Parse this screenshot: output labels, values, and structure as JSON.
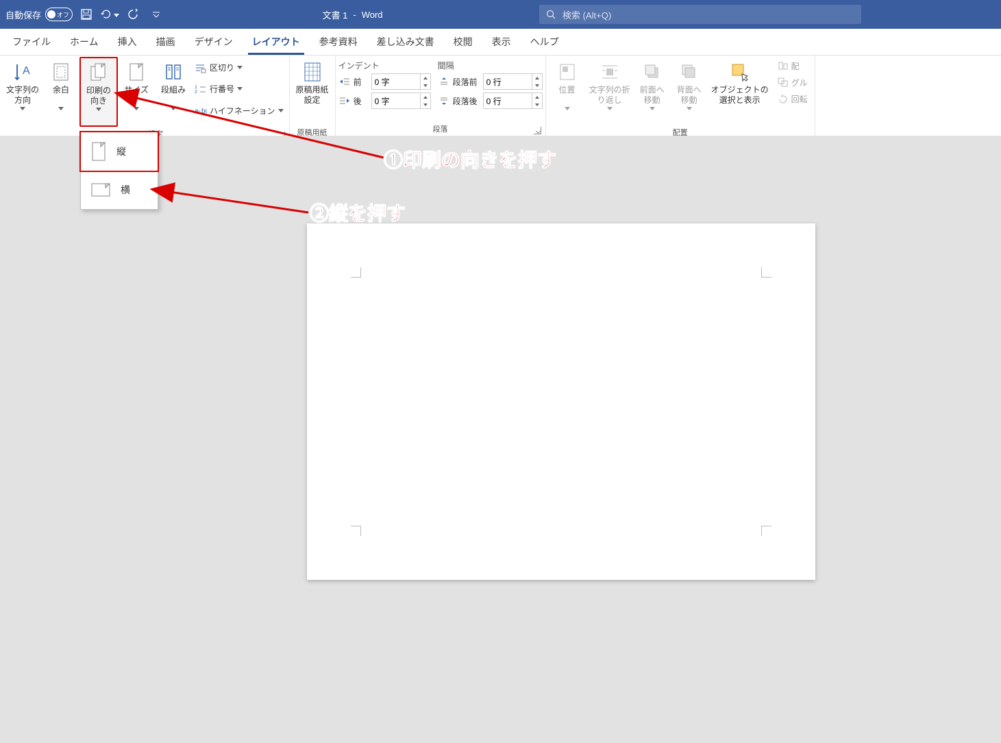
{
  "titlebar": {
    "autosave_label": "自動保存",
    "autosave_state": "オフ",
    "doc_title": "文書 1",
    "app_name": "Word",
    "search_placeholder": "検索 (Alt+Q)"
  },
  "tabs": {
    "file": "ファイル",
    "home": "ホーム",
    "insert": "挿入",
    "draw": "描画",
    "design": "デザイン",
    "layout": "レイアウト",
    "references": "参考資料",
    "mailings": "差し込み文書",
    "review": "校閲",
    "view": "表示",
    "help": "ヘルプ"
  },
  "ribbon": {
    "page_setup": {
      "text_direction": "文字列の\n方向",
      "margins": "余白",
      "orientation": "印刷の\n向き",
      "size": "サイズ",
      "columns": "段組み",
      "breaks": "区切り",
      "line_numbers": "行番号",
      "hyphenation": "ハイフネーション",
      "group_label": "ページ設定"
    },
    "manuscript": {
      "btn": "原稿用紙\n設定",
      "group_label": "原稿用紙"
    },
    "paragraph": {
      "indent_head": "インデント",
      "spacing_head": "間隔",
      "indent_before": "前",
      "indent_before_val": "0 字",
      "indent_after": "後",
      "indent_after_val": "0 字",
      "space_before": "段落前",
      "space_before_val": "0 行",
      "space_after": "段落後",
      "space_after_val": "0 行",
      "group_label": "段落"
    },
    "arrange": {
      "position": "位置",
      "wrap": "文字列の折\nり返し",
      "forward": "前面へ\n移動",
      "backward": "背面へ\n移動",
      "selection": "オブジェクトの\n選択と表示",
      "align": "配",
      "group": "グル",
      "rotate": "回転",
      "group_label": "配置"
    }
  },
  "dropdown": {
    "portrait": "縦",
    "landscape": "横"
  },
  "annotations": {
    "a1": "①印刷の向きを押す",
    "a2": "②縦を押す"
  }
}
